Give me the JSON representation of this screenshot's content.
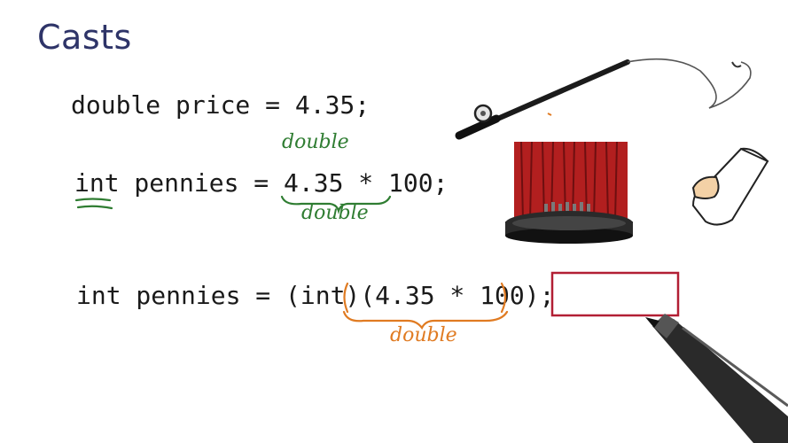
{
  "slide": {
    "title": "Casts",
    "lines": [
      "double price = 4.35;",
      "int pennies = 4.35 * 100;",
      "int pennies = (int)(4.35 * 100);"
    ],
    "annotations": {
      "above_literal": "double",
      "under_expression": "double",
      "under_cast_expression": "double"
    }
  },
  "colors": {
    "title": "#2e3468",
    "green_ink": "#2f7d32",
    "orange_ink": "#e07b22",
    "box_outline": "#b21f34"
  }
}
